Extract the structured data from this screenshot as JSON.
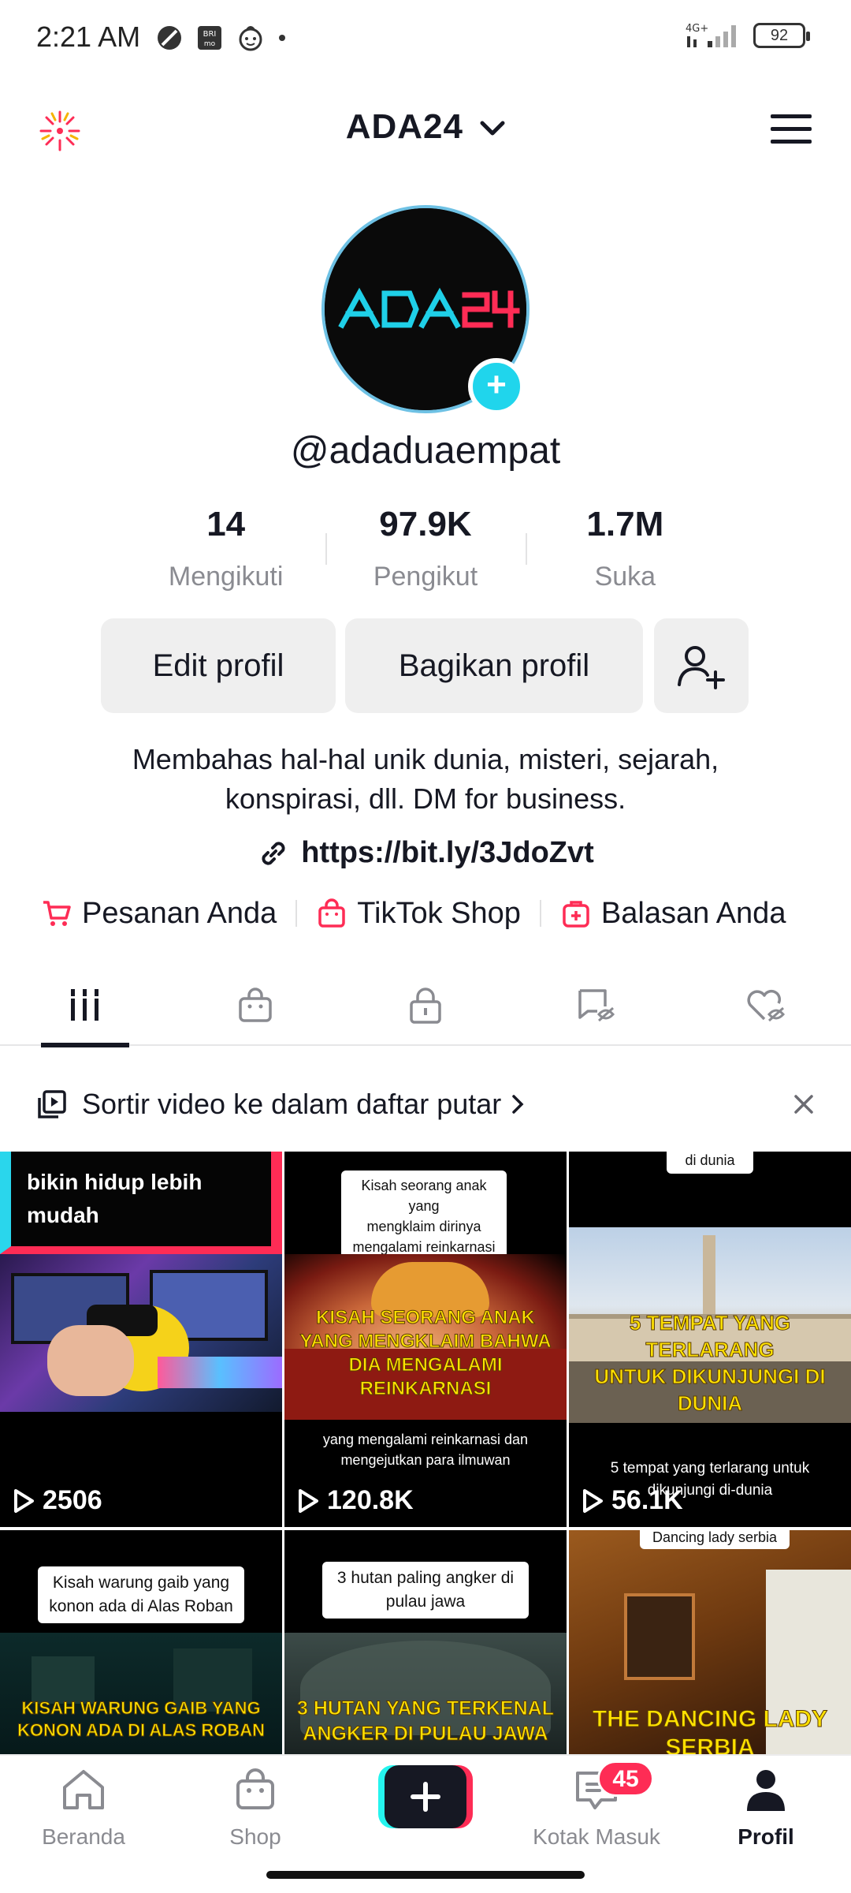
{
  "status_bar": {
    "time": "2:21 AM",
    "network": "4G+",
    "battery": "92"
  },
  "header": {
    "username_title": "ADA24"
  },
  "profile": {
    "avatar_text": "ADA24",
    "handle": "@adaduaempat",
    "stats": [
      {
        "value": "14",
        "label": "Mengikuti"
      },
      {
        "value": "97.9K",
        "label": "Pengikut"
      },
      {
        "value": "1.7M",
        "label": "Suka"
      }
    ],
    "buttons": {
      "edit": "Edit profil",
      "share": "Bagikan profil"
    },
    "bio_line1": "Membahas hal-hal unik dunia, misteri, sejarah,",
    "bio_line2": "konspirasi, dll. DM for business.",
    "link": "https://bit.ly/3JdoZvt"
  },
  "shop_row": [
    {
      "label": "Pesanan Anda",
      "icon": "cart-icon"
    },
    {
      "label": "TikTok Shop",
      "icon": "shop-bag-icon"
    },
    {
      "label": "Balasan Anda",
      "icon": "plus-box-icon"
    }
  ],
  "tabs": [
    {
      "icon": "videos-grid-icon",
      "active": true
    },
    {
      "icon": "shop-bag-icon",
      "active": false
    },
    {
      "icon": "lock-icon",
      "active": false
    },
    {
      "icon": "repost-hidden-icon",
      "active": false
    },
    {
      "icon": "liked-hidden-icon",
      "active": false
    }
  ],
  "sort_banner": {
    "text": "Sortir video ke dalam daftar putar"
  },
  "videos": [
    {
      "views": "2506",
      "text_top_line1": "bikin hidup lebih",
      "text_top_line2": "mudah"
    },
    {
      "views": "120.8K",
      "caption_line1": "Kisah seorang anak yang",
      "caption_line2": "mengklaim dirinya",
      "caption_line3": "mengalami reinkarnasi",
      "headline_line1": "KISAH SEORANG ANAK",
      "headline_line2": "YANG MENGKLAIM BAHWA",
      "headline_line3": "DIA MENGALAMI REINKARNASI",
      "sub_line1": "yang mengalami reinkarnasi dan",
      "sub_line2": "mengejutkan para ilmuwan"
    },
    {
      "views": "56.1K",
      "top_label": "di dunia",
      "headline_line1": "5 TEMPAT YANG TERLARANG",
      "headline_line2": "UNTUK DIKUNJUNGI DI DUNIA",
      "sub_line1": "5 tempat yang terlarang untuk",
      "sub_line2": "dikunjungi di-dunia"
    },
    {
      "caption_line1": "Kisah warung gaib yang",
      "caption_line2": "konon ada di Alas Roban",
      "headline_line1": "KISAH WARUNG GAIB YANG",
      "headline_line2": "KONON ADA DI ALAS ROBAN"
    },
    {
      "caption_line1": "3 hutan paling angker di",
      "caption_line2": "pulau jawa",
      "headline_line1": "3 HUTAN YANG TERKENAL",
      "headline_line2": "ANGKER DI PULAU JAWA"
    },
    {
      "top_label": "Dancing lady serbia",
      "headline_line1": "THE DANCING LADY SERBIA"
    }
  ],
  "bottom_nav": {
    "home": "Beranda",
    "shop": "Shop",
    "inbox": "Kotak Masuk",
    "inbox_badge": "45",
    "profile": "Profil"
  },
  "colors": {
    "accent": "#fe2c55",
    "cyan": "#20d5ec",
    "text": "#161823",
    "muted": "#8a8b91"
  }
}
